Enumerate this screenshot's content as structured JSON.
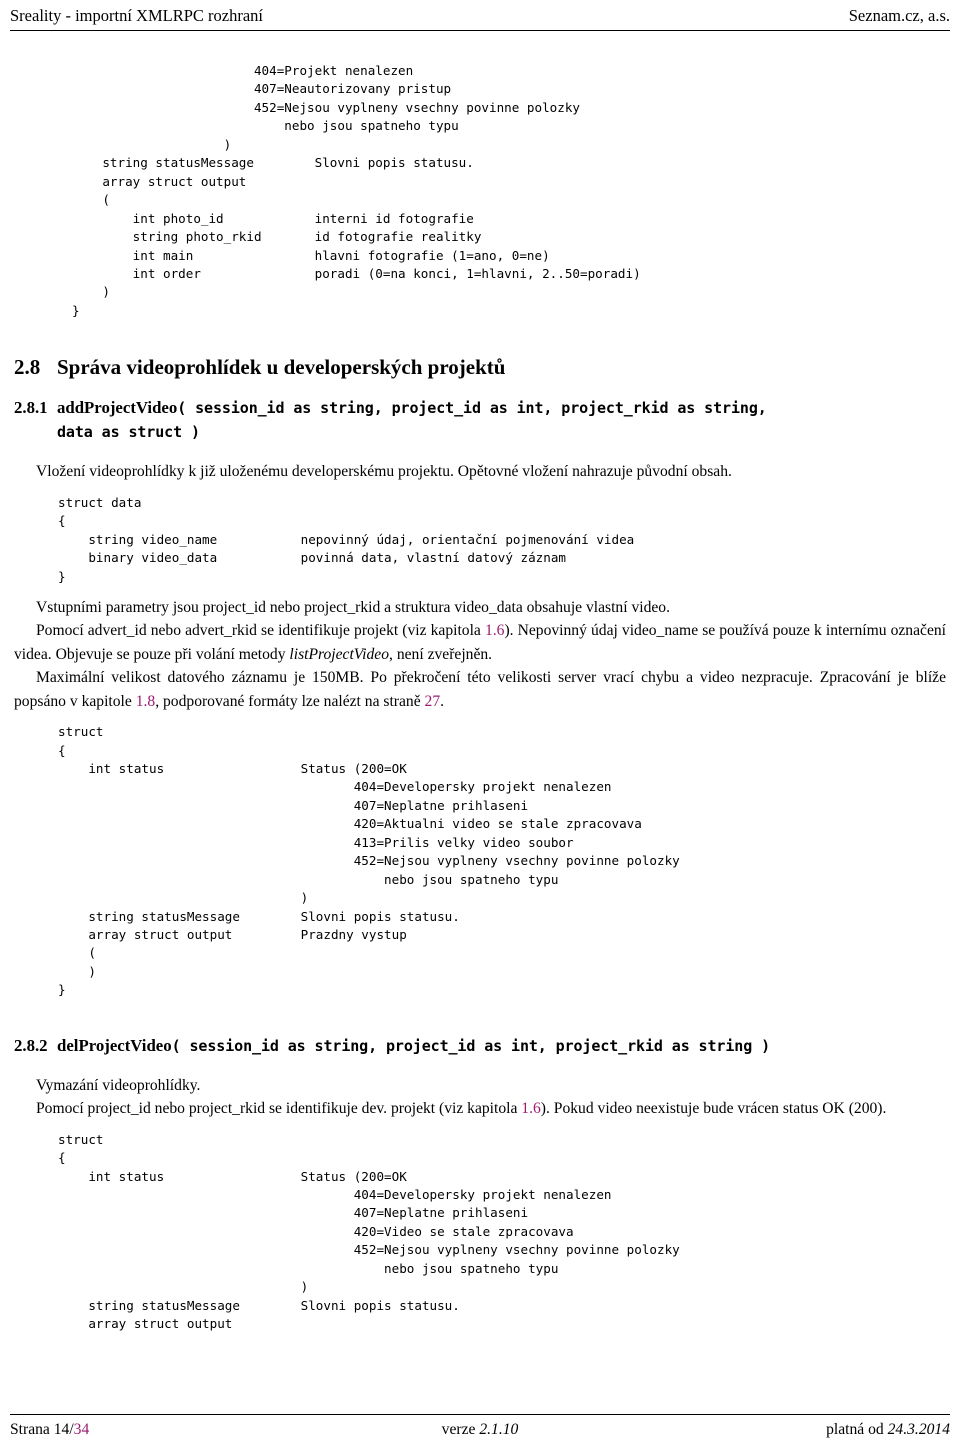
{
  "header": {
    "left": "Sreality - importní XMLRPC rozhraní",
    "right": "Seznam.cz, a.s."
  },
  "code_block_top": "                        404=Projekt nenalezen\n                        407=Neautorizovany pristup\n                        452=Nejsou vyplneny vsechny povinne polozky\n                            nebo jsou spatneho typu\n                    )\n    string statusMessage        Slovni popis statusu.\n    array struct output\n    (\n        int photo_id            interni id fotografie\n        string photo_rkid       id fotografie realitky\n        int main                hlavni fotografie (1=ano, 0=ne)\n        int order               poradi (0=na konci, 1=hlavni, 2..50=poradi)\n    )\n}",
  "section": {
    "number": "2.8",
    "title": "Správa videoprohlídek u developerských projektů"
  },
  "subsection_1": {
    "number": "2.8.1",
    "name": "addProjectVideo",
    "signature_line1": "( session_id as string, project_id as int, project_rkid as string,",
    "signature_line2": "data as struct )",
    "intro": "Vložení videoprohlídky k již uloženému developerskému projektu. Opětovné vložení nahrazuje původní obsah.",
    "code_data": "struct data\n{\n    string video_name           nepovinný údaj, orientační pojmenování videa\n    binary video_data           povinná data, vlastní datový záznam\n}",
    "para_1": "Vstupními parametry jsou project_id nebo project_rkid a struktura video_data obsahuje vlastní video.",
    "para_2_a": "Pomocí advert_id nebo advert_rkid se identifikuje projekt (viz kapitola ",
    "para_2_link": "1.6",
    "para_2_b": "). Nepovinný údaj video_name se používá pouze k internímu označení videa. Objevuje se pouze při volání metody ",
    "para_2_italic": "listProjectVideo",
    "para_2_c": ", není zveřejněn.",
    "para_3_a": "Maximální velikost datového záznamu je 150MB. Po překročení této velikosti server vrací chybu a video nezpracuje. Zpracování je blíže popsáno v kapitole ",
    "para_3_link": "1.8",
    "para_3_b": ", podporované formáty lze nalézt na straně ",
    "para_3_link2": "27",
    "para_3_c": ".",
    "code_result": "struct\n{\n    int status                  Status (200=OK\n                                       404=Developersky projekt nenalezen\n                                       407=Neplatne prihlaseni\n                                       420=Aktualni video se stale zpracovava\n                                       413=Prilis velky video soubor\n                                       452=Nejsou vyplneny vsechny povinne polozky\n                                           nebo jsou spatneho typu\n                                )\n    string statusMessage        Slovni popis statusu.\n    array struct output         Prazdny vystup\n    (\n    )\n}"
  },
  "subsection_2": {
    "number": "2.8.2",
    "name": "delProjectVideo",
    "signature_line1": "( session_id as string, project_id as int, project_rkid as string )",
    "intro": "Vymazání videoprohlídky.",
    "para_1_a": "Pomocí project_id nebo project_rkid se identifikuje dev. projekt (viz kapitola ",
    "para_1_link": "1.6",
    "para_1_b": "). Pokud video neexistuje bude vrácen status OK (200).",
    "code_result": "struct\n{\n    int status                  Status (200=OK\n                                       404=Developersky projekt nenalezen\n                                       407=Neplatne prihlaseni\n                                       420=Video se stale zpracovava\n                                       452=Nejsou vyplneny vsechny povinne polozky\n                                           nebo jsou spatneho typu\n                                )\n    string statusMessage        Slovni popis statusu.\n    array struct output"
  },
  "footer": {
    "page_label": "Strana 14/",
    "page_total": "34",
    "version_label": "verze ",
    "version_value": "2.1.10",
    "valid_label": "platná od ",
    "valid_value": "24.3.2014"
  },
  "colors": {
    "link": "#9c1b6e",
    "text": "#000000",
    "background": "#ffffff"
  }
}
